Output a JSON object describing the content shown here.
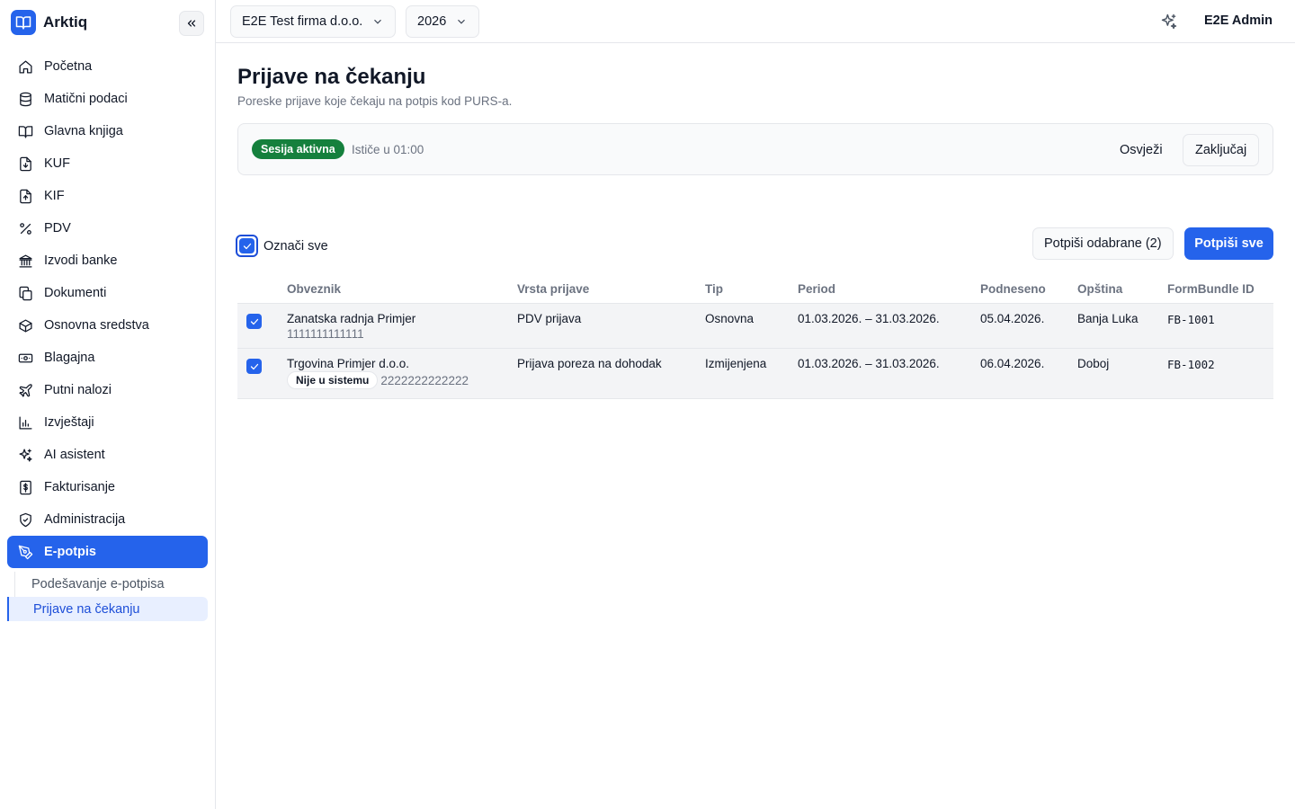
{
  "app": {
    "name": "Arktiq"
  },
  "sidebar": {
    "items": [
      {
        "label": "Početna",
        "icon": "home-icon"
      },
      {
        "label": "Matični podaci",
        "icon": "database-icon"
      },
      {
        "label": "Glavna knjiga",
        "icon": "book-icon"
      },
      {
        "label": "KUF",
        "icon": "file-in-icon"
      },
      {
        "label": "KIF",
        "icon": "file-out-icon"
      },
      {
        "label": "PDV",
        "icon": "percent-icon"
      },
      {
        "label": "Izvodi banke",
        "icon": "bank-icon"
      },
      {
        "label": "Dokumenti",
        "icon": "documents-icon"
      },
      {
        "label": "Osnovna sredstva",
        "icon": "box-icon"
      },
      {
        "label": "Blagajna",
        "icon": "cash-icon"
      },
      {
        "label": "Putni nalozi",
        "icon": "plane-icon"
      },
      {
        "label": "Izvještaji",
        "icon": "chart-icon"
      },
      {
        "label": "AI asistent",
        "icon": "sparkles-icon"
      },
      {
        "label": "Fakturisanje",
        "icon": "invoice-icon"
      },
      {
        "label": "Administracija",
        "icon": "shield-icon"
      },
      {
        "label": "E-potpis",
        "icon": "pen-icon",
        "active": true
      }
    ],
    "subitems": [
      {
        "label": "Podešavanje e-potpisa"
      },
      {
        "label": "Prijave na čekanju",
        "active": true
      }
    ]
  },
  "topbar": {
    "company": "E2E Test firma d.o.o.",
    "year": "2026",
    "user": "E2E Admin"
  },
  "page": {
    "title": "Prijave na čekanju",
    "subtitle": "Poreske prijave koje čekaju na potpis kod PURS-a."
  },
  "session": {
    "status": "Sesija aktivna",
    "expires": "Ističe u 01:00",
    "refresh_label": "Osvježi",
    "lock_label": "Zaključaj"
  },
  "toolbar": {
    "select_all_label": "Označi sve",
    "select_all_checked": true,
    "sign_selected_label": "Potpiši odabrane (2)",
    "sign_all_label": "Potpiši sve"
  },
  "table": {
    "columns": [
      "Obveznik",
      "Vrsta prijave",
      "Tip",
      "Period",
      "Podneseno",
      "Opština",
      "FormBundle ID"
    ],
    "rows": [
      {
        "checked": true,
        "obveznik": "Zanatska radnja Primjer",
        "jib": "1111111111111",
        "badge": "",
        "vrsta": "PDV prijava",
        "tip": "Osnovna",
        "period": "01.03.2026. – 31.03.2026.",
        "podneseno": "05.04.2026.",
        "opstina": "Banja Luka",
        "form_bundle_id": "FB-1001"
      },
      {
        "checked": true,
        "obveznik": "Trgovina Primjer d.o.o.",
        "jib": "2222222222222",
        "badge": "Nije u sistemu",
        "vrsta": "Prijava poreza na dohodak",
        "tip": "Izmijenjena",
        "period": "01.03.2026. – 31.03.2026.",
        "podneseno": "06.04.2026.",
        "opstina": "Doboj",
        "form_bundle_id": "FB-1002"
      }
    ]
  },
  "colors": {
    "accent": "#2563eb",
    "success": "#15803d",
    "row_bg": "#f3f4f6"
  }
}
